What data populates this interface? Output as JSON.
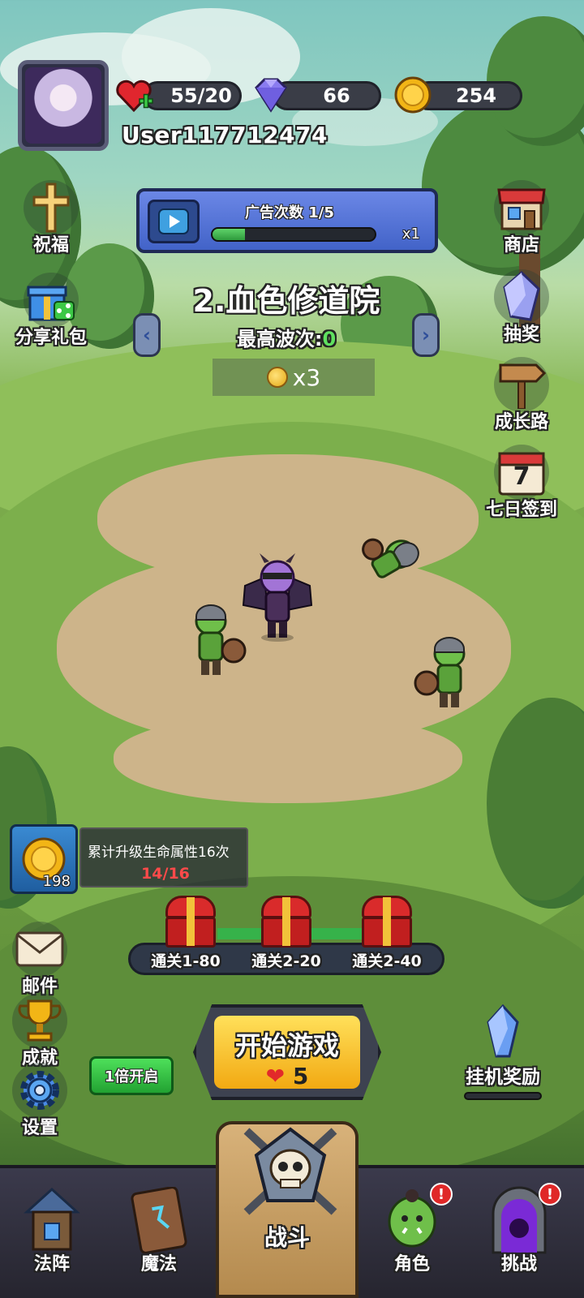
{
  "header": {
    "username": "User117712474",
    "hearts": "55/20",
    "gems": "66",
    "coins": "254"
  },
  "left_buttons": [
    {
      "label": "祝福",
      "icon": "cross-icon"
    },
    {
      "label": "分享礼包",
      "icon": "gift-share-icon"
    }
  ],
  "right_buttons": [
    {
      "label": "商店",
      "icon": "shop-icon"
    },
    {
      "label": "抽奖",
      "icon": "crystal-icon"
    },
    {
      "label": "成长路",
      "icon": "signpost-icon"
    },
    {
      "label": "七日签到",
      "icon": "calendar-icon",
      "day": "7"
    }
  ],
  "ad": {
    "title": "广告次数 1/5",
    "progress": 0.2,
    "multiplier": "x1"
  },
  "stage": {
    "title": "2.血色修道院",
    "wave_label": "最高波次:",
    "wave_value": "0",
    "coin_multiplier": "x3"
  },
  "quest": {
    "icon_count": "198",
    "text": "累计升级生命属性16次",
    "progress": "14/16"
  },
  "chests": [
    {
      "label": "通关1-80"
    },
    {
      "label": "通关2-20"
    },
    {
      "label": "通关2-40"
    }
  ],
  "bottom_left_buttons": [
    {
      "label": "邮件",
      "icon": "mail-icon"
    },
    {
      "label": "成就",
      "icon": "trophy-icon"
    },
    {
      "label": "设置",
      "icon": "gear-icon"
    }
  ],
  "speed_button": "1倍开启",
  "start": {
    "title": "开始游戏",
    "cost": "5"
  },
  "idle_reward": "挂机奖励",
  "nav": [
    {
      "label": "法阵",
      "icon": "tower-icon"
    },
    {
      "label": "魔法",
      "icon": "spellbook-icon"
    },
    {
      "label": "战斗",
      "icon": "skull-swords-icon"
    },
    {
      "label": "角色",
      "icon": "orc-icon"
    },
    {
      "label": "挑战",
      "icon": "portal-icon"
    }
  ],
  "colors": {
    "accent_green": "#36b24a",
    "heart_red": "#e22a2a",
    "coin_gold": "#e4a814",
    "ad_blue": "#4263c8"
  }
}
